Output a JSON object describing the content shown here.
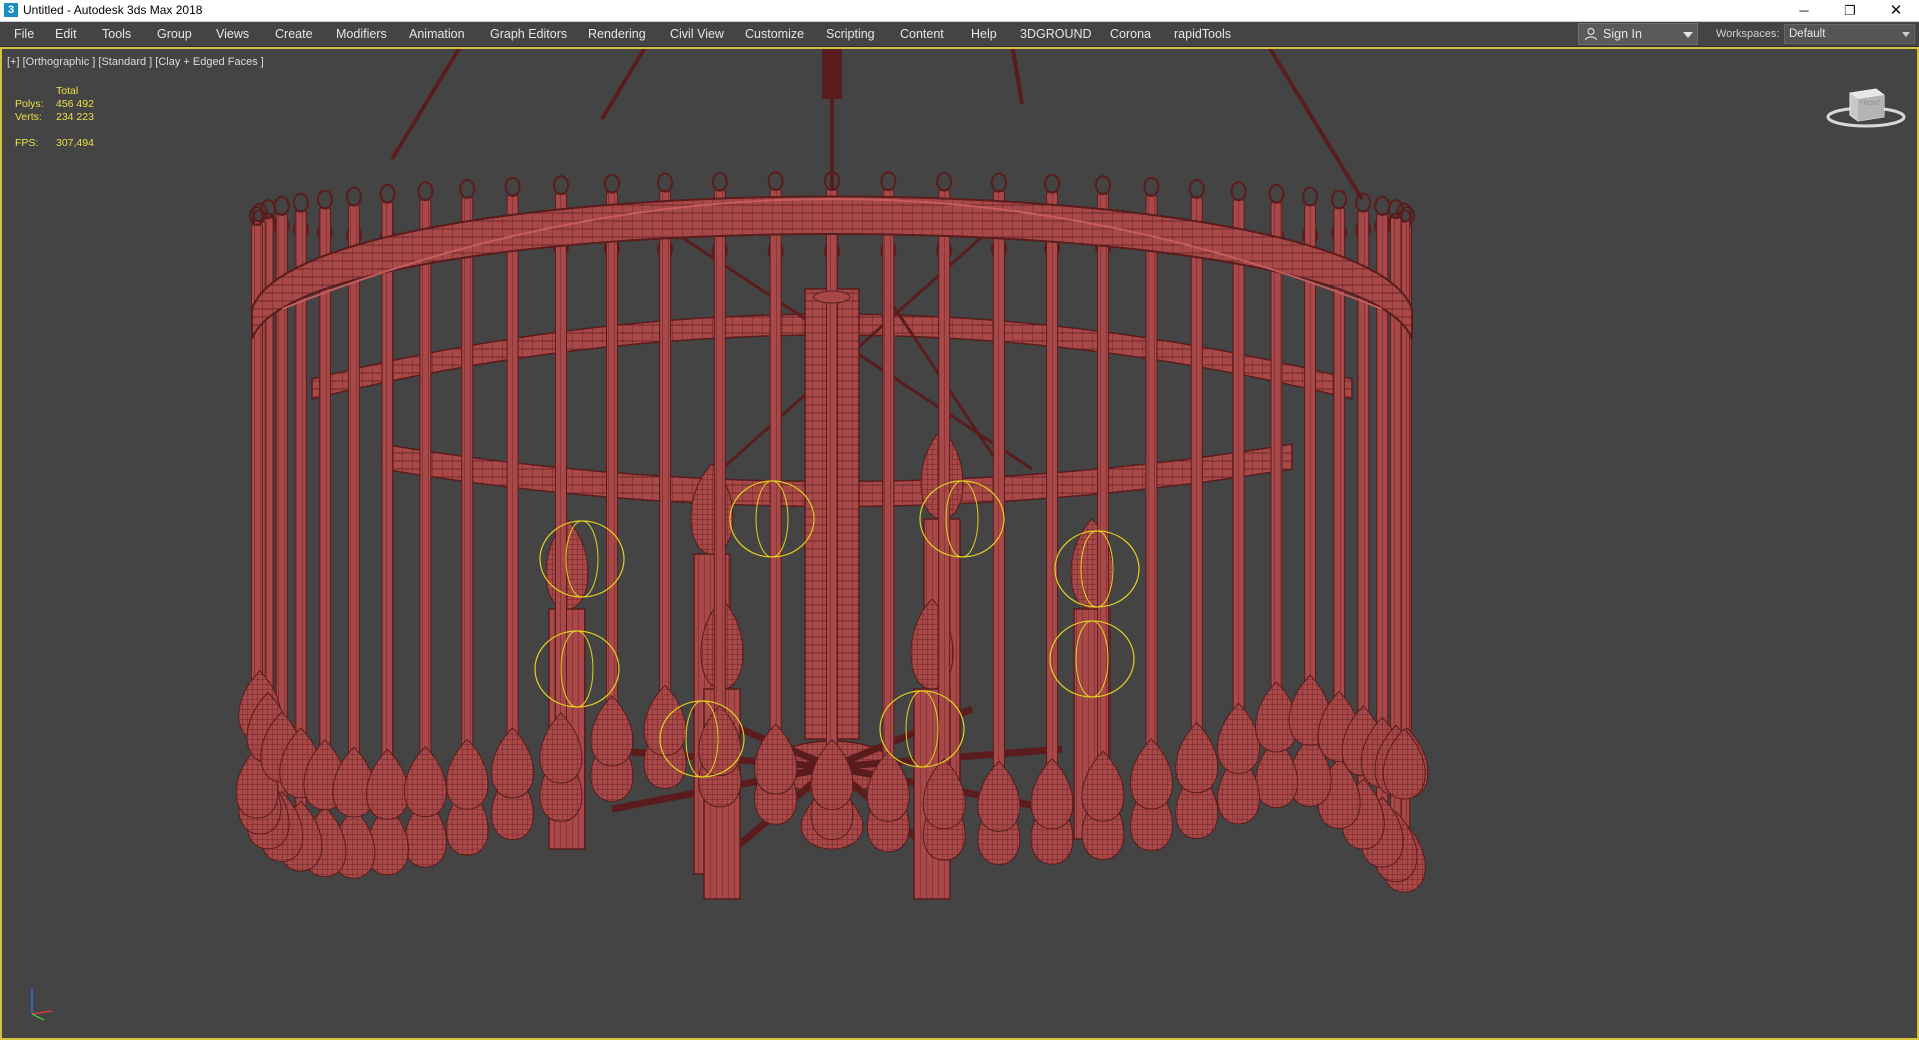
{
  "window": {
    "title": "Untitled - Autodesk 3ds Max 2018",
    "app_icon_glyph": "3",
    "controls": {
      "minimize": "─",
      "maximize": "❐",
      "close": "✕"
    }
  },
  "menu": {
    "items": [
      {
        "label": "File"
      },
      {
        "label": "Edit"
      },
      {
        "label": "Tools"
      },
      {
        "label": "Group"
      },
      {
        "label": "Views"
      },
      {
        "label": "Create"
      },
      {
        "label": "Modifiers"
      },
      {
        "label": "Animation"
      },
      {
        "label": "Graph Editors"
      },
      {
        "label": "Rendering"
      },
      {
        "label": "Civil View"
      },
      {
        "label": "Customize"
      },
      {
        "label": "Scripting"
      },
      {
        "label": "Content"
      },
      {
        "label": "Help"
      },
      {
        "label": "3DGROUND"
      },
      {
        "label": "Corona"
      },
      {
        "label": "rapidTools"
      }
    ],
    "sign_in_label": "Sign In",
    "workspaces_label": "Workspaces:",
    "workspace_value": "Default"
  },
  "viewport": {
    "label": "[+] [Orthographic ] [Standard ] [Clay + Edged Faces ]",
    "stats": {
      "total_label": "Total",
      "polys_label": "Polys:",
      "polys_value": "456 492",
      "verts_label": "Verts:",
      "verts_value": "234 223",
      "fps_label": "FPS:",
      "fps_value": "307,494"
    },
    "viewcube_label": "FRONT"
  },
  "colors": {
    "model": "#a84848",
    "model_dark": "#5a1c1c",
    "model_light": "#c45e5e",
    "light_gizmo": "#e0d020",
    "viewport_bg": "#444444",
    "stats_text": "#e8e04a",
    "active_border": "#d6c23a"
  }
}
